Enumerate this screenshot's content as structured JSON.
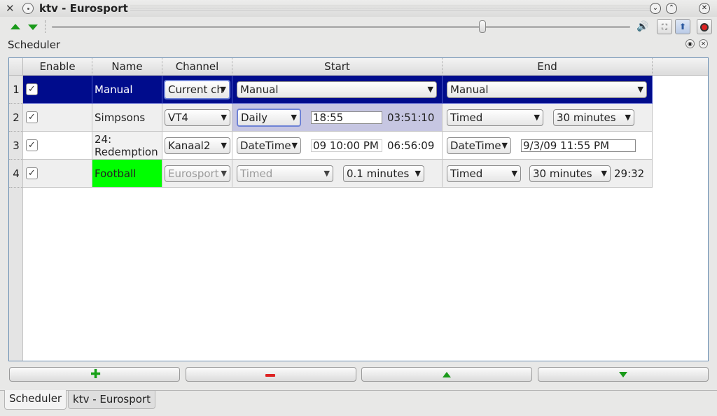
{
  "window": {
    "title": "ktv - Eurosport",
    "buttons": {
      "minimize": "⌄",
      "maximize": "⌃",
      "close": "✕"
    }
  },
  "toolbar": {
    "volume_icon": "speaker-icon",
    "fullscreen_icon": "fullscreen-icon",
    "upload_icon": "up-arrow-icon",
    "record_icon": "record-icon"
  },
  "panel": {
    "title": "Scheduler"
  },
  "table": {
    "headers": [
      "Enable",
      "Name",
      "Channel",
      "Start",
      "End"
    ],
    "rows": [
      {
        "num": "1",
        "enabled": "✓",
        "name": "Manual",
        "channel": "Current ch",
        "start_mode": "Manual",
        "end_mode": "Manual"
      },
      {
        "num": "2",
        "enabled": "✓",
        "name": "Simpsons",
        "channel": "VT4",
        "start_mode": "Daily",
        "start_time": "18:55",
        "start_remaining": "03:51:10",
        "end_mode": "Timed",
        "end_duration": "30 minutes"
      },
      {
        "num": "3",
        "enabled": "✓",
        "name": "24: Redemption",
        "channel": "Kanaal2",
        "start_mode": "DateTime",
        "start_datetime": "09 10:00 PM",
        "start_remaining": "06:56:09",
        "end_mode": "DateTime",
        "end_datetime": "9/3/09 11:55 PM"
      },
      {
        "num": "4",
        "enabled": "✓",
        "name": "Football",
        "channel": "Eurosport",
        "start_mode": "Timed",
        "start_duration": "0.1 minutes",
        "end_mode": "Timed",
        "end_duration": "30 minutes",
        "end_remaining": "29:32"
      }
    ]
  },
  "buttons": {
    "add": "add-icon",
    "remove": "remove-icon",
    "move_up": "move-up-icon",
    "move_down": "move-down-icon"
  },
  "tabs": [
    "Scheduler",
    "ktv - Eurosport"
  ],
  "colors": {
    "selection": "#000c8c",
    "active_row_highlight": "#00ff00",
    "accent_green": "#1a9a1a",
    "record_red": "#d22222"
  }
}
